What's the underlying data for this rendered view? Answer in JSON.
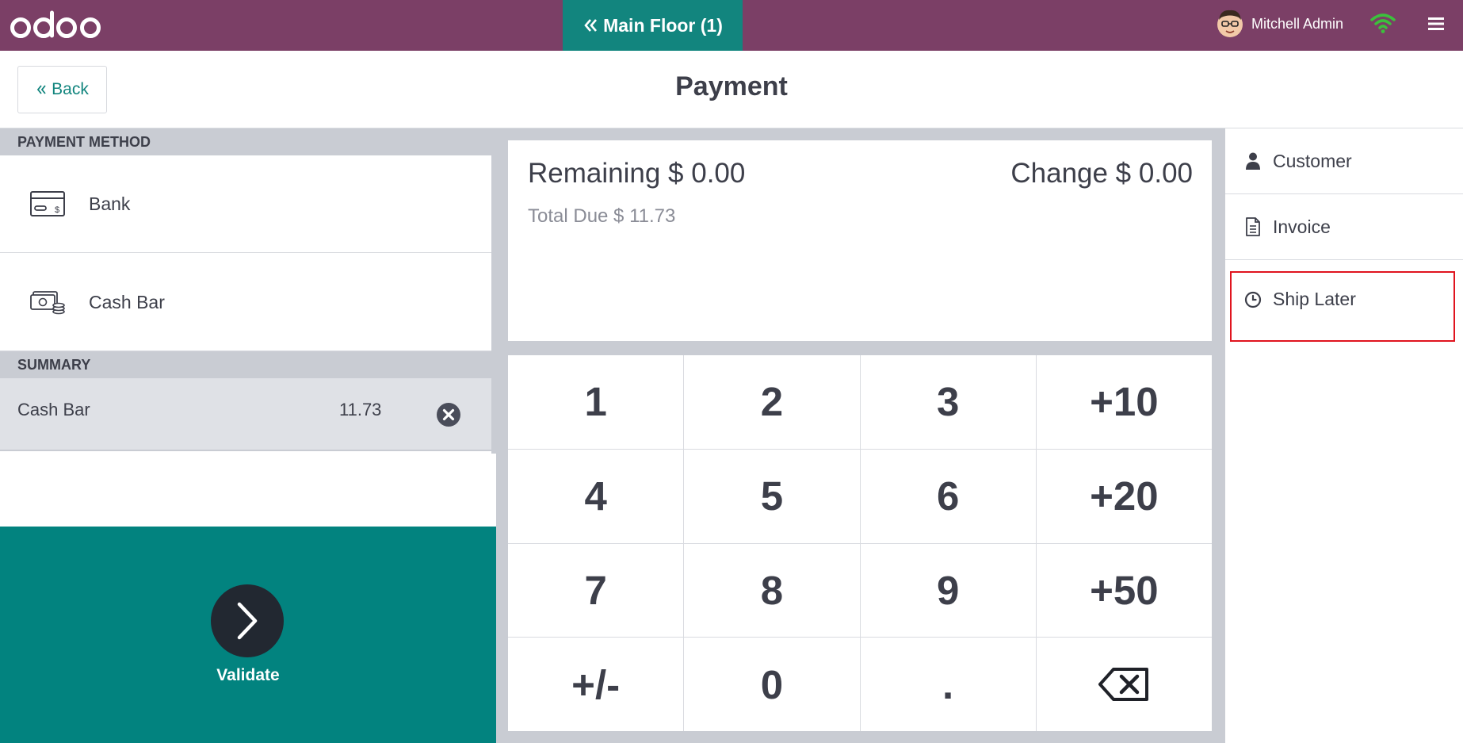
{
  "navbar": {
    "logo_text": "odoo",
    "floor_tab": "Main Floor (1)",
    "user_name": "Mitchell Admin",
    "colors": {
      "navbar": "#7b3f66",
      "floor_tab": "#12857e",
      "wifi": "#3cc03c"
    }
  },
  "header": {
    "back_label": "Back",
    "title": "Payment"
  },
  "payment_methods": {
    "heading": "PAYMENT METHOD",
    "items": [
      {
        "label": "Bank",
        "icon": "card-icon"
      },
      {
        "label": "Cash Bar",
        "icon": "cash-icon"
      }
    ]
  },
  "summary": {
    "heading": "SUMMARY",
    "lines": [
      {
        "name": "Cash Bar",
        "amount": "11.73"
      }
    ]
  },
  "validate": {
    "label": "Validate",
    "color": "#02837f"
  },
  "status": {
    "remaining": "Remaining $ 0.00",
    "change": "Change $ 0.00",
    "total_due": "Total Due  $ 11.73"
  },
  "numpad": {
    "keys": [
      "1",
      "2",
      "3",
      "+10",
      "4",
      "5",
      "6",
      "+20",
      "7",
      "8",
      "9",
      "+50",
      "+/-",
      "0",
      ".",
      "backspace-icon"
    ]
  },
  "sidebar": {
    "customer_label": "Customer",
    "invoice_label": "Invoice",
    "ship_later_label": "Ship Later",
    "highlight_color": "#e0141e"
  }
}
